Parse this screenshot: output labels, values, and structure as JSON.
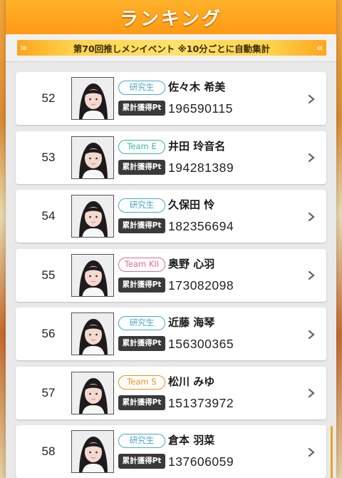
{
  "header": {
    "title": "ランキング"
  },
  "event": {
    "text": "第70回推しメンイベント ※10分ごとに自動集計"
  },
  "points_label": "累計獲得Pt",
  "colors": {
    "accent": "#ff9a14",
    "team_colors": {
      "研究生": "#4aa7cc",
      "Team E": "#36b6a0",
      "Team KII": "#e46a8a",
      "Team S": "#f08c1e"
    }
  },
  "rows": [
    {
      "rank": "52",
      "team": "研究生",
      "name": "佐々木 希美",
      "points": "196590115"
    },
    {
      "rank": "53",
      "team": "Team E",
      "name": "井田 玲音名",
      "points": "194281389"
    },
    {
      "rank": "54",
      "team": "研究生",
      "name": "久保田 怜",
      "points": "182356694"
    },
    {
      "rank": "55",
      "team": "Team KII",
      "name": "奥野 心羽",
      "points": "173082098"
    },
    {
      "rank": "56",
      "team": "研究生",
      "name": "近藤 海琴",
      "points": "156300365"
    },
    {
      "rank": "57",
      "team": "Team S",
      "name": "松川 みゆ",
      "points": "151373972"
    },
    {
      "rank": "58",
      "team": "研究生",
      "name": "倉本 羽菜",
      "points": "137606059"
    }
  ]
}
